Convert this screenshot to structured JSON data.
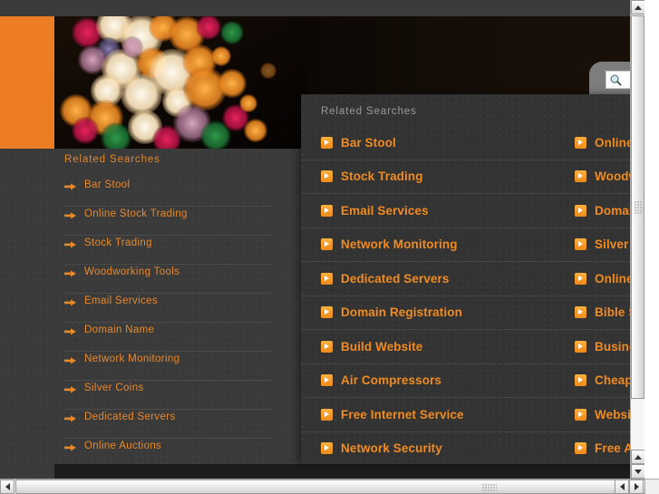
{
  "colors": {
    "accent_orange": "#ec7d23",
    "link_orange": "#e8892b",
    "panel_link_orange": "#ef8b21",
    "page_bg": "#3a3a3a",
    "panel_bg": "#333333",
    "panel_header_gray": "#9b9b9b"
  },
  "search": {
    "icon": "magnifier-icon",
    "value": "",
    "placeholder": ""
  },
  "sidebar": {
    "title": "Related Searches",
    "items": [
      {
        "label": "Bar Stool",
        "icon": "arrow-bullet-icon"
      },
      {
        "label": "Online Stock Trading",
        "icon": "arrow-bullet-icon"
      },
      {
        "label": "Stock Trading",
        "icon": "arrow-bullet-icon"
      },
      {
        "label": "Woodworking Tools",
        "icon": "arrow-bullet-icon"
      },
      {
        "label": "Email Services",
        "icon": "arrow-bullet-icon"
      },
      {
        "label": "Domain Name",
        "icon": "arrow-bullet-icon"
      },
      {
        "label": "Network Monitoring",
        "icon": "arrow-bullet-icon"
      },
      {
        "label": "Silver Coins",
        "icon": "arrow-bullet-icon"
      },
      {
        "label": "Dedicated Servers",
        "icon": "arrow-bullet-icon"
      },
      {
        "label": "Online Auctions",
        "icon": "arrow-bullet-icon"
      }
    ]
  },
  "overlay": {
    "title": "Related Searches",
    "rows": [
      {
        "left": "Bar Stool",
        "right": "Online"
      },
      {
        "left": "Stock Trading",
        "right": "Woodw"
      },
      {
        "left": "Email Services",
        "right": "Domain"
      },
      {
        "left": "Network Monitoring",
        "right": "Silver C"
      },
      {
        "left": "Dedicated Servers",
        "right": "Online"
      },
      {
        "left": "Domain Registration",
        "right": "Bible S"
      },
      {
        "left": "Build Website",
        "right": "Busine"
      },
      {
        "left": "Air Compressors",
        "right": "Cheap"
      },
      {
        "left": "Free Internet Service",
        "right": "Website"
      },
      {
        "left": "Network Security",
        "right": "Free An"
      }
    ]
  },
  "scrollbars": {
    "vertical_up": "scroll-up-arrow",
    "vertical_down": "scroll-down-arrow",
    "horizontal_left": "scroll-left-arrow",
    "horizontal_right": "scroll-right-arrow"
  }
}
